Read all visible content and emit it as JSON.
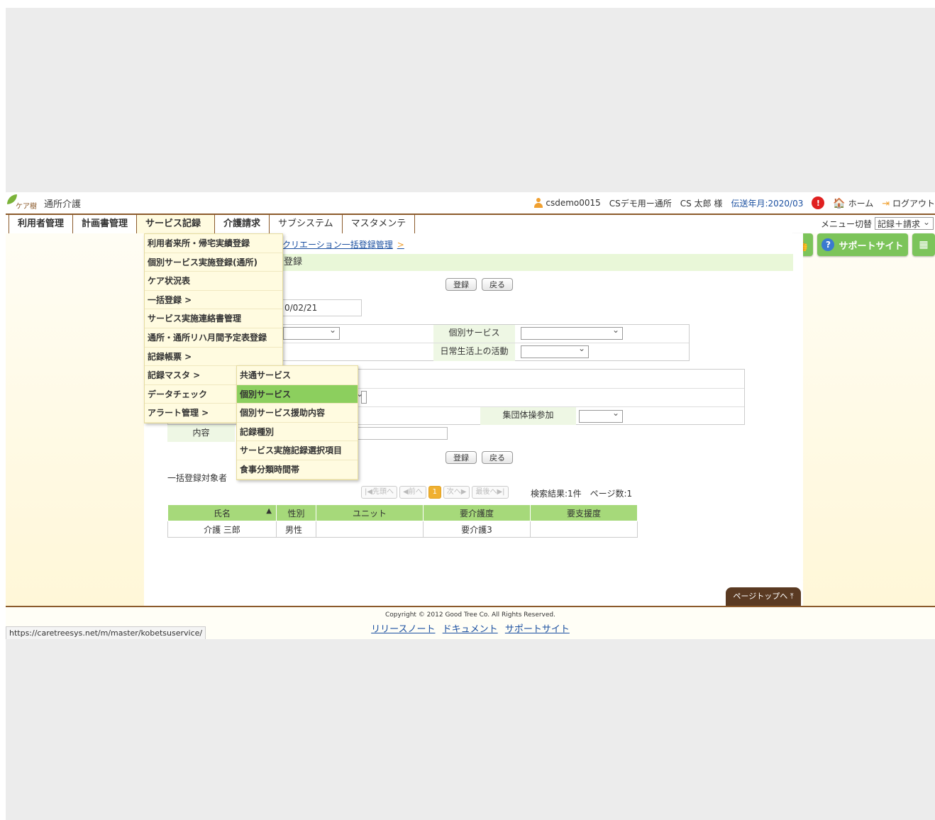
{
  "header": {
    "logo_text": "ケア樹",
    "app_name": "通所介護",
    "user_id": "csdemo0015",
    "facility": "CSデモ用ー通所",
    "user_name": "CS 太郎 様",
    "transmission": "伝送年月:2020/03",
    "notice_badge": "!",
    "home": "ホーム",
    "logout": "ログアウト"
  },
  "nav": {
    "items": [
      "利用者管理",
      "計画書管理",
      "サービス記録",
      "介護請求",
      "サブシステム",
      "マスタメンテ"
    ],
    "menu_switch_label": "メニュー切替",
    "menu_switch_value": "記録＋請求"
  },
  "right_buttons": {
    "support": "サポートサイト"
  },
  "breadcrumb": "クリエーション一括登録管理",
  "page_title": "登録",
  "buttons": {
    "register": "登録",
    "back": "戻る"
  },
  "form": {
    "date_value": "0/02/21",
    "individual_service_label": "個別サービス",
    "daily_activity_label": "日常生活上の活動",
    "group_exercise_label": "集団体操参加",
    "content_label": "内容"
  },
  "dropdown": {
    "items": [
      "利用者来所・帰宅実績登録",
      "個別サービス実施登録(通所)",
      "ケア状況表",
      "一括登録 >",
      "サービス実施連絡書管理",
      "通所・通所リハ月間予定表登録",
      "記録帳票 >",
      "記録マスタ >",
      "データチェック",
      "アラート管理 >"
    ]
  },
  "submenu": {
    "items": [
      "共通サービス",
      "個別サービス",
      "個別サービス援助内容",
      "記録種別",
      "サービス実施記録選択項目",
      "食事分類時間帯"
    ],
    "highlighted_index": 1
  },
  "bulk_target_label": "一括登録対象者",
  "pager": {
    "first": "|◀先頭へ",
    "prev": "◀前へ",
    "current": "1",
    "next": "次へ▶",
    "last": "最後へ▶|",
    "search_result": "検索結果:1件　ページ数:1"
  },
  "table": {
    "headers": [
      "氏名",
      "性別",
      "ユニット",
      "要介護度",
      "要支援度"
    ],
    "sort_indicator": "▲",
    "rows": [
      [
        "介護 三郎",
        "男性",
        "",
        "要介護3",
        ""
      ]
    ]
  },
  "pagetop": "ページトップへ",
  "footer": {
    "copyright": "Copyright © 2012 Good Tree Co. All Rights Reserved.",
    "links": [
      "リリースノート",
      "ドキュメント",
      "サポートサイト"
    ],
    "status_url": "https://caretreesys.net/m/master/kobetsuservice/"
  }
}
